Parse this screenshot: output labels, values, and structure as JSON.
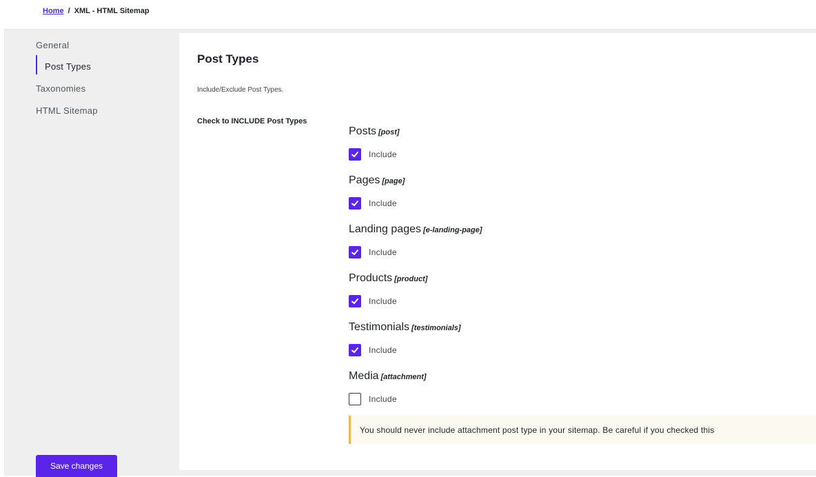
{
  "breadcrumb": {
    "home": "Home",
    "separator": "/",
    "current": "XML - HTML Sitemap"
  },
  "sidebar": {
    "items": [
      {
        "label": "General",
        "active": false
      },
      {
        "label": "Post Types",
        "active": true
      },
      {
        "label": "Taxonomies",
        "active": false
      },
      {
        "label": "HTML Sitemap",
        "active": false
      }
    ],
    "save_label": "Save changes"
  },
  "panel": {
    "title": "Post Types",
    "description": "Include/Exclude Post Types.",
    "field_label": "Check to INCLUDE Post Types",
    "post_types": [
      {
        "name": "Posts",
        "slug": "[post]",
        "checked": true,
        "check_label": "Include"
      },
      {
        "name": "Pages",
        "slug": "[page]",
        "checked": true,
        "check_label": "Include"
      },
      {
        "name": "Landing pages",
        "slug": "[e-landing-page]",
        "checked": true,
        "check_label": "Include"
      },
      {
        "name": "Products",
        "slug": "[product]",
        "checked": true,
        "check_label": "Include"
      },
      {
        "name": "Testimonials",
        "slug": "[testimonials]",
        "checked": true,
        "check_label": "Include"
      },
      {
        "name": "Media",
        "slug": "[attachment]",
        "checked": false,
        "check_label": "Include"
      }
    ],
    "notice": "You should never include attachment post type in your sitemap. Be careful if you checked this"
  },
  "colors": {
    "accent": "#5a24ea",
    "notice_border": "#f0b849",
    "notice_bg": "#fcf9f0",
    "sidebar_bg": "#efeff0"
  },
  "icons": {
    "checkbox_checked": "checkmark-icon"
  }
}
